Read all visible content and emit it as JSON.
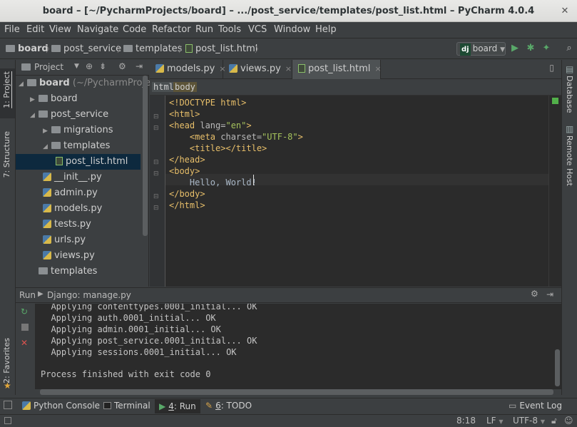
{
  "window": {
    "title": "board – [~/PycharmProjects/board] – .../post_service/templates/post_list.html – PyCharm 4.0.4"
  },
  "menu": [
    "File",
    "Edit",
    "View",
    "Navigate",
    "Code",
    "Refactor",
    "Run",
    "Tools",
    "VCS",
    "Window",
    "Help"
  ],
  "nav": {
    "crumbs": [
      "board",
      "post_service",
      "templates",
      "post_list.html"
    ],
    "run_config": "board"
  },
  "left_strip": {
    "project": "1: Project",
    "structure": "7: Structure",
    "favorites": "2: Favorites"
  },
  "right_strip": {
    "database": "Database",
    "remote": "Remote Host"
  },
  "project": {
    "header": "Project",
    "tree": [
      {
        "label": "board",
        "suffix": " (~/PycharmProjec",
        "type": "folder",
        "arrow": "down",
        "indent": 0
      },
      {
        "label": "board",
        "type": "folder",
        "arrow": "right",
        "indent": 1
      },
      {
        "label": "post_service",
        "type": "folder",
        "arrow": "down",
        "indent": 1
      },
      {
        "label": "migrations",
        "type": "folder",
        "arrow": "right",
        "indent": 2
      },
      {
        "label": "templates",
        "type": "folder",
        "arrow": "down",
        "indent": 2
      },
      {
        "label": "post_list.html",
        "type": "html",
        "arrow": "",
        "indent": 3
      },
      {
        "label": "__init__.py",
        "type": "py",
        "arrow": "",
        "indent": 2
      },
      {
        "label": "admin.py",
        "type": "py",
        "arrow": "",
        "indent": 2
      },
      {
        "label": "models.py",
        "type": "py",
        "arrow": "",
        "indent": 2
      },
      {
        "label": "tests.py",
        "type": "py",
        "arrow": "",
        "indent": 2
      },
      {
        "label": "urls.py",
        "type": "py",
        "arrow": "",
        "indent": 2
      },
      {
        "label": "views.py",
        "type": "py",
        "arrow": "",
        "indent": 2
      },
      {
        "label": "templates",
        "type": "folder",
        "arrow": "",
        "indent": 1
      }
    ]
  },
  "editor": {
    "tabs": [
      {
        "label": "models.py",
        "close": "×"
      },
      {
        "label": "views.py",
        "close": "×"
      },
      {
        "label": "post_list.html",
        "close": "×"
      }
    ],
    "breadcrumb": [
      "html",
      "body"
    ],
    "code": [
      "<!DOCTYPE html>",
      "<html>",
      "<head lang=\"en\">",
      "    <meta charset=\"UTF-8\">",
      "    <title></title>",
      "</head>",
      "<body>",
      "    Hello, World!",
      "</body>",
      "</html>"
    ]
  },
  "run": {
    "title": "Run",
    "config": "Django: manage.py",
    "output": [
      "  Applying contenttypes.0001_initial... OK",
      "  Applying auth.0001_initial... OK",
      "  Applying admin.0001_initial... OK",
      "  Applying post_service.0001_initial... OK",
      "  Applying sessions.0001_initial... OK",
      "",
      "Process finished with exit code 0"
    ]
  },
  "bottom_tabs": {
    "python_console": "Python Console",
    "terminal": "Terminal",
    "run_num": "4",
    "run_label": ": Run",
    "todo_num": "6",
    "todo_label": ": TODO",
    "event_log": "Event Log"
  },
  "status": {
    "position": "8:18",
    "line_sep": "LF",
    "encoding": "UTF-8"
  }
}
